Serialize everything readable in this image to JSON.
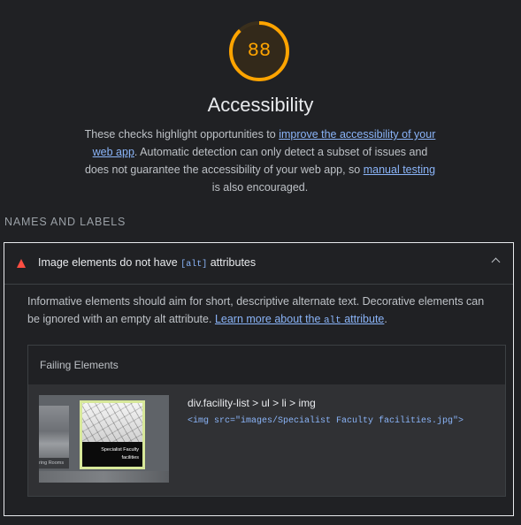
{
  "score": {
    "value": "88",
    "fraction": 0.88,
    "color": "#ffa400"
  },
  "category": {
    "title": "Accessibility",
    "desc_part1": "These checks highlight opportunities to ",
    "desc_link1": "improve the accessibility of your web app",
    "desc_part2": ". Automatic detection can only detect a subset of issues and does not guarantee the accessibility of your web app, so ",
    "desc_link2": "manual testing",
    "desc_part3": " is also encouraged."
  },
  "group": {
    "title": "NAMES AND LABELS"
  },
  "audit": {
    "status_icon": "fail-triangle-icon",
    "status_color": "#ff4e42",
    "title_part1": "Image elements do not have ",
    "title_code": "[alt]",
    "title_part2": " attributes",
    "toggle_icon": "chevron-up-icon",
    "desc_part1": "Informative elements should aim for short, descriptive alternate text. Decorative elements can be ignored with an empty alt attribute. ",
    "learn_more_part1": "Learn more about the ",
    "learn_more_code": "alt",
    "learn_more_part2": " attribute",
    "desc_end": ".",
    "table": {
      "header": "Failing Elements",
      "rows": [
        {
          "selector": "div.facility-list > ul > li > img",
          "snippet": "<img src=\"images/Specialist Faculty facilities.jpg\">",
          "thumb_left_caption": "ring Rooms",
          "thumb_banner_line1": "Specialist Faculty",
          "thumb_banner_line2": "facilities"
        }
      ]
    }
  }
}
